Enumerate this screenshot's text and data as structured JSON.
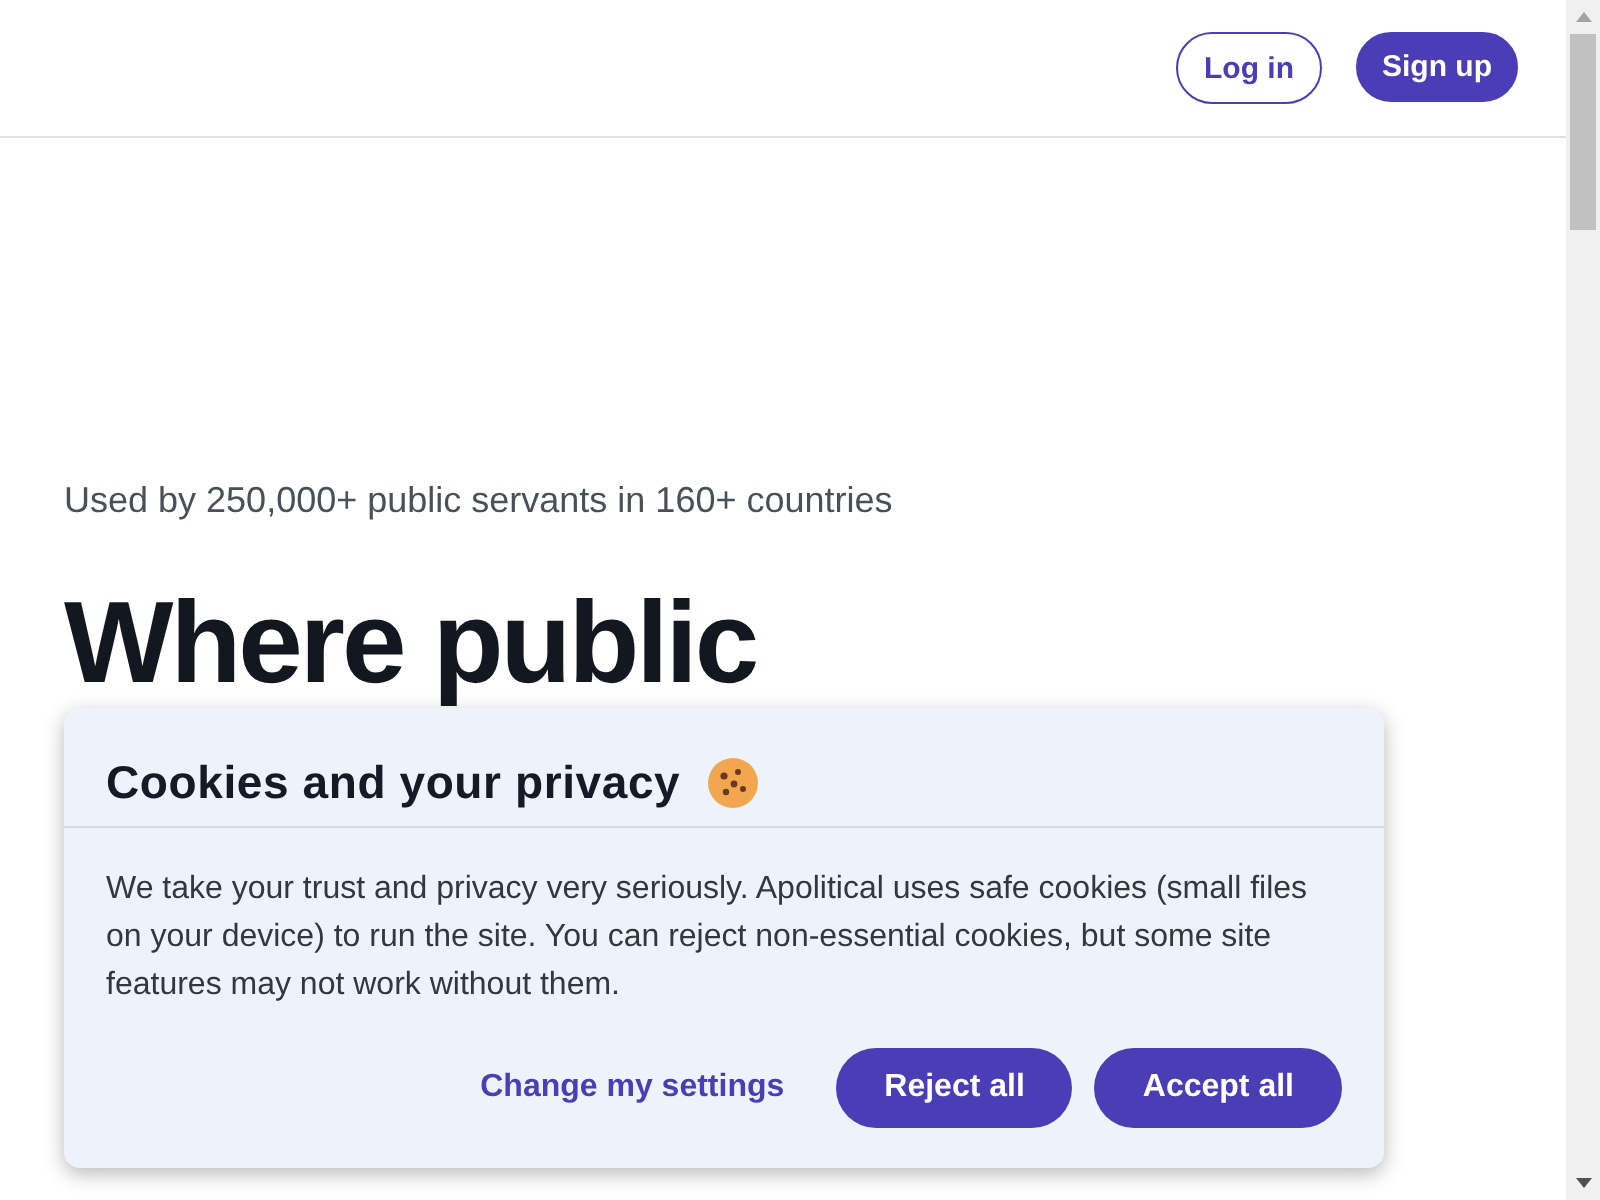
{
  "header": {
    "buttons": [
      {
        "label": "Log in",
        "kind": "outline"
      },
      {
        "label": "Sign up",
        "kind": "filled"
      }
    ]
  },
  "hero": {
    "tagline": "Used by 250,000+ public servants in 160+ countries",
    "heading": "Where public"
  },
  "cookie_banner": {
    "title": "Cookies and your privacy",
    "body": "We take your trust and privacy very seriously. Apolitical uses safe cookies (small files on your device) to run the site. You can reject non-essential cookies, but some site features may not work without them.",
    "link": "Change my settings",
    "buttons": [
      {
        "label": "Reject all"
      },
      {
        "label": "Accept all"
      }
    ]
  }
}
